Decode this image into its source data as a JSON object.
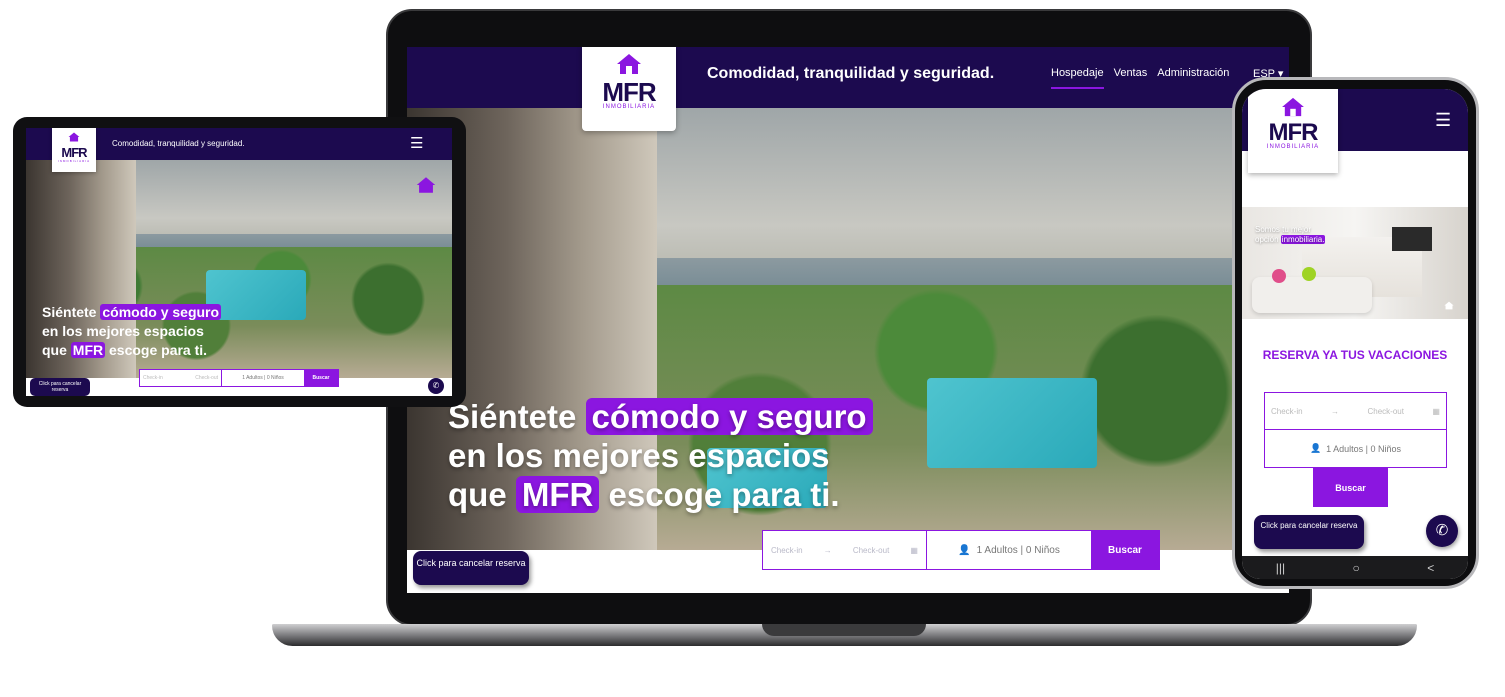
{
  "brand": {
    "logo_text": "MFR",
    "logo_sub": "INMOBILIARIA",
    "colors": {
      "navy": "#1c0a4f",
      "purple": "#8b16e0"
    }
  },
  "laptop": {
    "tagline": "Comodidad, tranquilidad y seguridad.",
    "nav": [
      "Hospedaje",
      "Ventas",
      "Administración"
    ],
    "lang": "ESP ▾",
    "headline": {
      "l1a": "Siéntete ",
      "l1b": "cómodo y seguro",
      "l2": "en los mejores espacios",
      "l3a": "que ",
      "l3b": "MFR",
      "l3c": " escoge para ti."
    },
    "cancel_label": "Click para cancelar reserva",
    "booking": {
      "checkin": "Check-in",
      "checkout": "Check-out",
      "guests": "1 Adultos | 0 Niños",
      "button": "Buscar"
    }
  },
  "tablet": {
    "tagline": "Comodidad, tranquilidad y seguridad.",
    "menu_icon": "☰",
    "headline": {
      "l1a": "Siéntete ",
      "l1b": "cómodo y seguro",
      "l2": "en los mejores espacios",
      "l3a": "que ",
      "l3b": "MFR",
      "l3c": " escoge para ti."
    },
    "cancel_label": "Click para cancelar reserva",
    "booking": {
      "checkin": "Check-in",
      "checkout": "Check-out",
      "guests": "1 Adultos | 0 Niños",
      "button": "Buscar"
    }
  },
  "phone": {
    "menu_icon": "☰",
    "hero_text_a": "Somos tu mejor",
    "hero_text_b": "opción ",
    "hero_text_c": "inmobiliaria.",
    "reserva_title": "RESERVA YA TUS VACACIONES",
    "booking": {
      "checkin": "Check-in",
      "checkout": "Check-out",
      "guests": "1 Adultos | 0 Niños",
      "button": "Buscar"
    },
    "cancel_label": "Click para cancelar reserva",
    "nav": [
      "|||",
      "○",
      "<"
    ]
  }
}
